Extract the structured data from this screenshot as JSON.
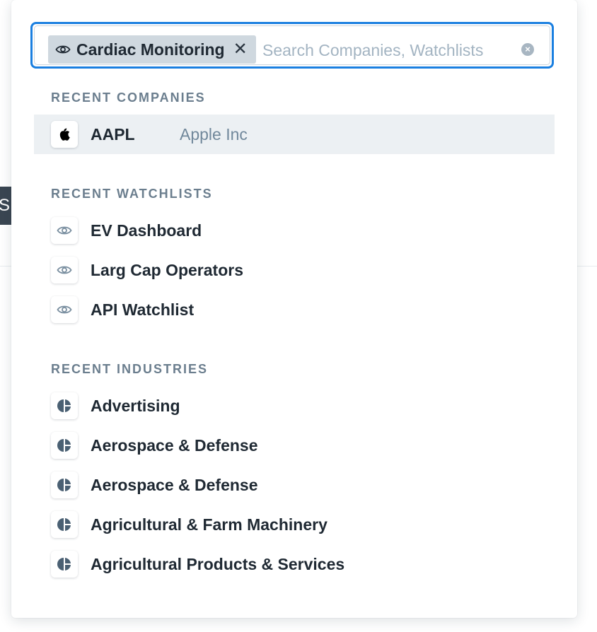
{
  "background": {
    "left_fragment_text": "S"
  },
  "search": {
    "chip": {
      "icon": "eye-icon",
      "label": "Cardiac Monitoring",
      "remove_glyph": "✕"
    },
    "value": "",
    "placeholder": "Search Companies, Watchlists",
    "clear_glyph": "×"
  },
  "recent_companies": {
    "heading": "RECENT COMPANIES",
    "items": [
      {
        "icon": "apple-logo-icon",
        "ticker": "AAPL",
        "name": "Apple Inc",
        "highlighted": true
      }
    ]
  },
  "recent_watchlists": {
    "heading": "RECENT WATCHLISTS",
    "items": [
      {
        "icon": "eye-icon",
        "label": "EV Dashboard"
      },
      {
        "icon": "eye-icon",
        "label": "Larg Cap Operators"
      },
      {
        "icon": "eye-icon",
        "label": "API Watchlist"
      }
    ]
  },
  "recent_industries": {
    "heading": "RECENT INDUSTRIES",
    "items": [
      {
        "icon": "industry-pie-icon",
        "label": "Advertising"
      },
      {
        "icon": "industry-pie-icon",
        "label": "Aerospace & Defense"
      },
      {
        "icon": "industry-pie-icon",
        "label": "Aerospace & Defense"
      },
      {
        "icon": "industry-pie-icon",
        "label": "Agricultural & Farm Machinery"
      },
      {
        "icon": "industry-pie-icon",
        "label": "Agricultural Products & Services"
      }
    ]
  },
  "colors": {
    "focus_ring": "#1a7fe0",
    "chip_bg": "#cfd8df",
    "section_heading": "#6b7e8e",
    "highlight_row": "#ecf0f3",
    "icon_stroke": "#7a8fa0",
    "industry_icon": "#4a6073"
  }
}
